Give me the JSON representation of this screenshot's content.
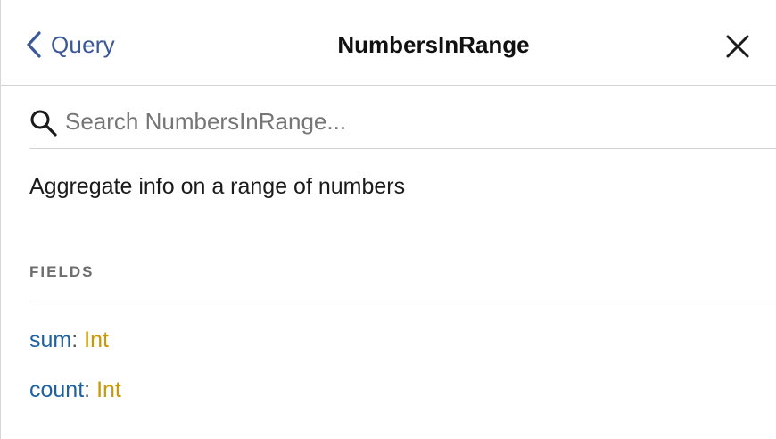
{
  "header": {
    "back_label": "Query",
    "title": "NumbersInRange"
  },
  "search": {
    "placeholder": "Search NumbersInRange...",
    "value": ""
  },
  "description": "Aggregate info on a range of numbers",
  "fields_section": {
    "heading": "FIELDS",
    "fields": [
      {
        "name": "sum",
        "separator": ": ",
        "type": "Int"
      },
      {
        "name": "count",
        "separator": ": ",
        "type": "Int"
      }
    ]
  },
  "colors": {
    "link": "#3b5998",
    "field_name": "#1f61a0",
    "type_name": "#ca9800",
    "heading": "#6e6e6e",
    "divider": "#d3d3d3"
  },
  "icons": {
    "back": "chevron-left-icon",
    "close": "close-icon",
    "search": "search-icon"
  }
}
